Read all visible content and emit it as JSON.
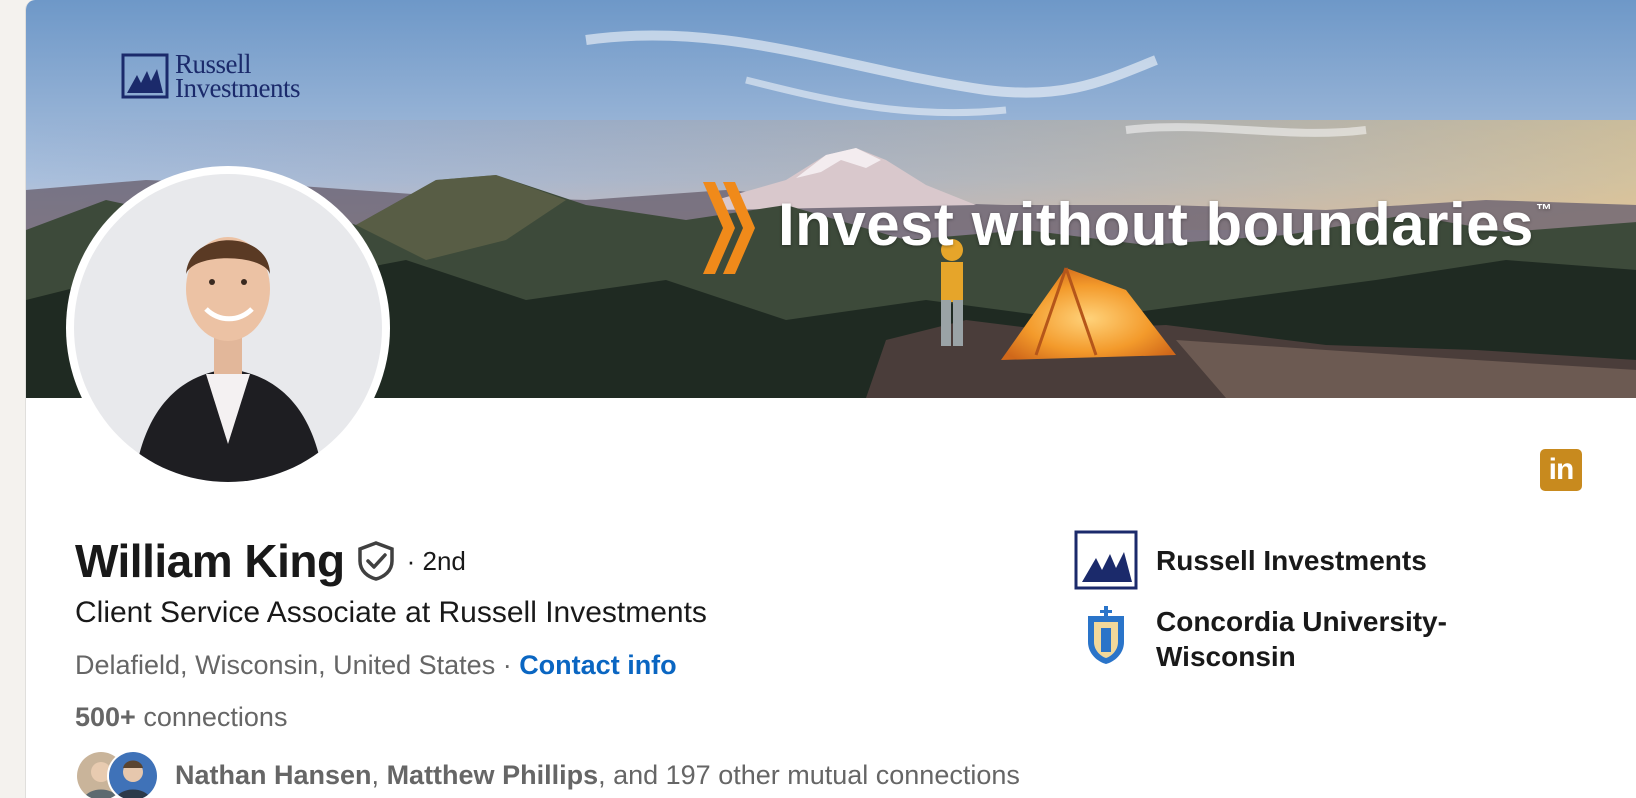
{
  "banner": {
    "brand_line": "Russell\nInvestments",
    "tagline": "Invest without boundaries",
    "trademark": "™"
  },
  "profile": {
    "name": "William King",
    "degree": "· 2nd",
    "headline": "Client Service Associate at Russell Investments",
    "location": "Delafield, Wisconsin, United States",
    "separator": " · ",
    "contact_info": "Contact info",
    "connections_count": "500+",
    "connections_label": "connections",
    "mutual": {
      "first": "Nathan Hansen",
      "comma": ", ",
      "second": "Matthew Phillips",
      "rest": ", and 197 other mutual connections"
    }
  },
  "badge": {
    "icon": "linkedin-icon",
    "text": "in"
  },
  "right_column": {
    "items": [
      {
        "label": "Russell Investments",
        "icon": "russell-investments-logo"
      },
      {
        "label": "Concordia University-\nWisconsin",
        "icon": "concordia-university-logo"
      }
    ]
  },
  "colors": {
    "link": "#0a66c2",
    "badge": "#c88a1e",
    "brand_navy": "#1b2a6b",
    "chevron_orange": "#f08a1a"
  }
}
